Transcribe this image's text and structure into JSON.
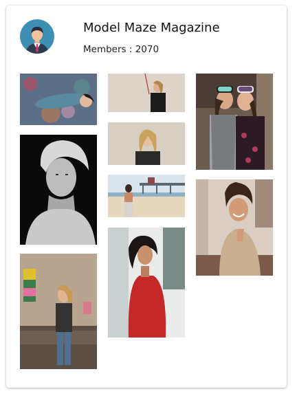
{
  "group": {
    "title": "Model Maze Magazine",
    "members_text": "Members : 2070"
  },
  "avatar_icon": "person-avatar-icon",
  "photos": [
    {
      "id": "photo-1",
      "desc_name": "woman-lying-on-patterned-blanket"
    },
    {
      "id": "photo-2",
      "desc_name": "woman-black-and-white-portrait"
    },
    {
      "id": "photo-3",
      "desc_name": "woman-holding-painting-on-couch"
    },
    {
      "id": "photo-4",
      "desc_name": "woman-with-rope-studio"
    },
    {
      "id": "photo-5",
      "desc_name": "woman-smiling-beige-background"
    },
    {
      "id": "photo-6",
      "desc_name": "woman-on-beach-pier"
    },
    {
      "id": "photo-7",
      "desc_name": "woman-red-dress-window"
    },
    {
      "id": "photo-8",
      "desc_name": "two-women-ski-goggles"
    },
    {
      "id": "photo-9",
      "desc_name": "woman-smiling-knit-sweater"
    }
  ]
}
